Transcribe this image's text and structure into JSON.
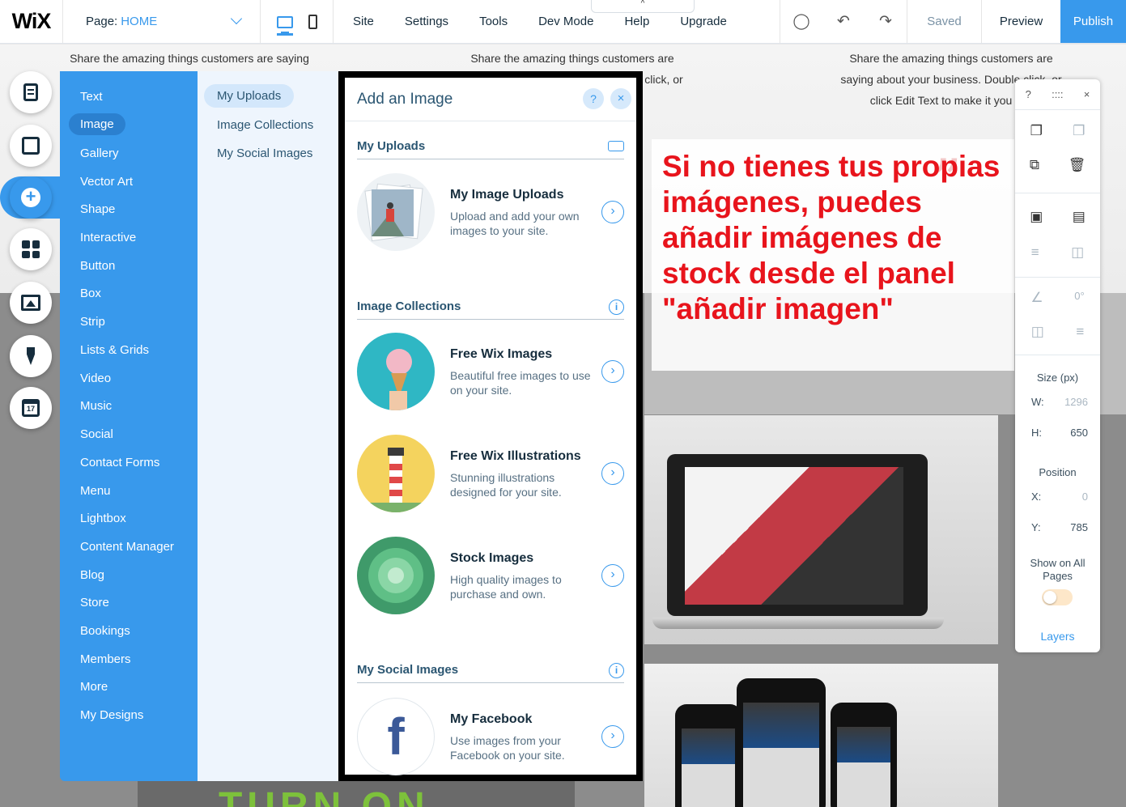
{
  "topbar": {
    "logo": "WiX",
    "page_label": "Page:",
    "page_value": "HOME",
    "menu": [
      "Site",
      "Settings",
      "Tools",
      "Dev Mode",
      "Help",
      "Upgrade"
    ],
    "collapse_glyph": "^",
    "tool_icons": [
      "zoom-out-icon",
      "undo-icon",
      "redo-icon"
    ],
    "saved": "Saved",
    "preview": "Preview",
    "publish": "Publish"
  },
  "canvas": {
    "testimonial_1": "Share the amazing things customers are saying",
    "testimonial_2": "Share the amazing things customers are",
    "testimonial_2b": "click, or",
    "testimonial_3a": "Share the amazing things customers are",
    "testimonial_3b": "saying about your business. Double click, or",
    "testimonial_3c": "click Edit Text to make it you",
    "turn_on": "TURN ON"
  },
  "rail": {
    "items": [
      "pages-icon",
      "background-icon",
      "add-icon",
      "apps-icon",
      "media-icon",
      "blog-pen-icon",
      "bookings-calendar-icon"
    ],
    "calendar_day": "17"
  },
  "categories": [
    "Text",
    "Image",
    "Gallery",
    "Vector Art",
    "Shape",
    "Interactive",
    "Button",
    "Box",
    "Strip",
    "Lists & Grids",
    "Video",
    "Music",
    "Social",
    "Contact Forms",
    "Menu",
    "Lightbox",
    "Content Manager",
    "Blog",
    "Store",
    "Bookings",
    "Members",
    "More",
    "My Designs"
  ],
  "selected_category": "Image",
  "subcategories": [
    "My Uploads",
    "Image Collections",
    "My Social Images"
  ],
  "add_image": {
    "title": "Add an Image",
    "help": "?",
    "close": "×",
    "sections": {
      "uploads": "My Uploads",
      "collections": "Image Collections",
      "social": "My Social Images"
    },
    "info_glyph": "i",
    "arrow_glyph": "›",
    "cards": [
      {
        "title": "My Image Uploads",
        "desc": "Upload and add your own images to your site."
      },
      {
        "title": "Free Wix Images",
        "desc": "Beautiful free images to use on your site."
      },
      {
        "title": "Free Wix Illustrations",
        "desc": "Stunning illustrations designed for your site."
      },
      {
        "title": "Stock Images",
        "desc": "High quality images to purchase and own."
      },
      {
        "title": "My Facebook",
        "desc": "Use images from your Facebook on your site."
      }
    ],
    "facebook_glyph": "f"
  },
  "annotation": {
    "text": "Si no tienes tus propias imágenes, puedes añadir imágenes de stock desde el panel \"añadir imagen\"",
    "quote_glyph": "”"
  },
  "right_panel": {
    "help": "?",
    "drag": "::::",
    "close": "×",
    "angle": "0°",
    "size_label": "Size (px)",
    "w_label": "W:",
    "w_value": "1296",
    "h_label": "H:",
    "h_value": "650",
    "position_label": "Position",
    "x_label": "X:",
    "x_value": "0",
    "y_label": "Y:",
    "y_value": "785",
    "show_on_all": "Show on All Pages",
    "layers": "Layers"
  },
  "colors": {
    "accent": "#3899ec",
    "annotation": "#e8141c"
  }
}
